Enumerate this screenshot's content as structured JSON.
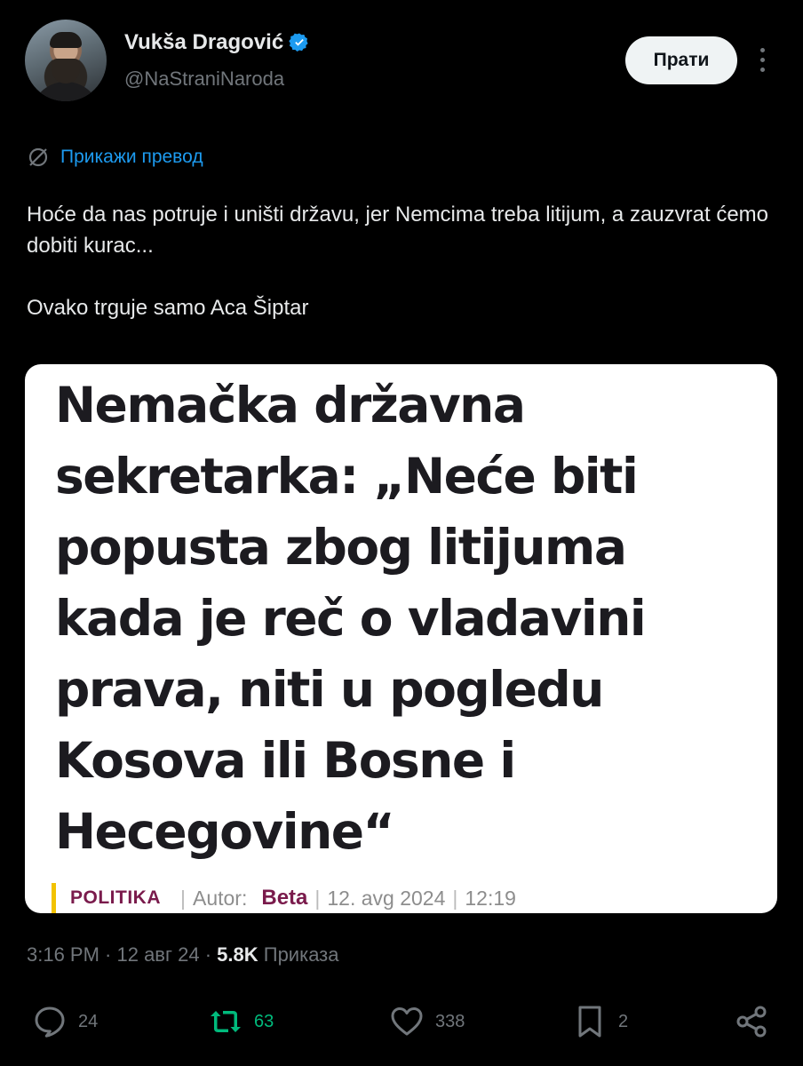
{
  "author": {
    "name": "Vukša Dragović",
    "handle": "@NaStraniNaroda",
    "verified": true
  },
  "follow_button": "Прати",
  "translate_label": "Прикажи превод",
  "tweet_text": [
    "Hoće da nas potruje i uništi državu, jer Nemcima treba litijum, a zauzvrat ćemo dobiti kurac...",
    "Ovako trguje samo Aca Šiptar"
  ],
  "media": {
    "headline": "Nemačka državna sekretarka: „Neće biti popusta zbog litijuma kada je reč o vladavini prava, niti u pogledu Kosova ili Bosne i Hecegovine“",
    "section": "POLITIKA",
    "author_label": "Autor:",
    "author": "Beta",
    "date": "12. avg 2024",
    "time": "12:19"
  },
  "timestamp": {
    "prefix": "3:16 PM · 12 авг 24 · ",
    "views_count": "5.8K",
    "views_label": " Приказа"
  },
  "actions": {
    "replies": "24",
    "reposts": "63",
    "likes": "338",
    "bookmarks": "2"
  },
  "colors": {
    "background": "#000000",
    "link": "#1d9bf0",
    "repost": "#00ba7c",
    "verified": "#1d9bf0",
    "muted": "#71767b"
  }
}
